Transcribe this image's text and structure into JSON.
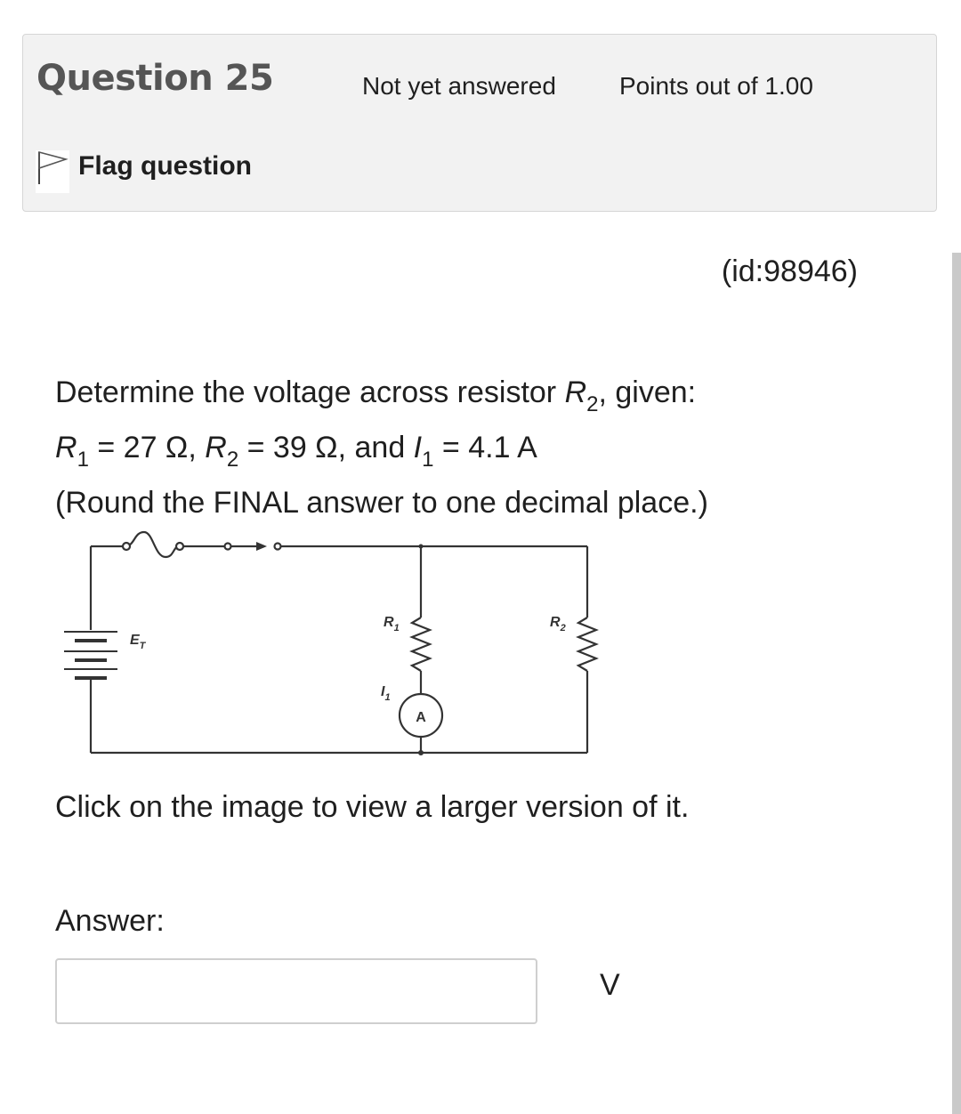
{
  "header": {
    "question_word": "Question",
    "question_number": "25",
    "state": "Not yet answered",
    "grade": "Points out of 1.00",
    "flag_label": "Flag question"
  },
  "question": {
    "id_text": "(id:98946)",
    "line1_prefix": "Determine the voltage across resistor ",
    "line1_var": "R",
    "line1_sub": "2",
    "line1_suffix": ", given:",
    "line2": {
      "r1_var": "R",
      "r1_sub": "1",
      "r1_val": " = 27 Ω, ",
      "r2_var": "R",
      "r2_sub": "2",
      "r2_val": " = 39 Ω, and ",
      "i1_var": "I",
      "i1_sub": "1",
      "i1_val": " = 4.1 A"
    },
    "line3": "(Round the FINAL answer to one decimal place.)",
    "click_note": "Click on the image to view a larger version of it."
  },
  "circuit": {
    "source_label": "E",
    "source_sub": "T",
    "r1_label": "R",
    "r1_sub": "1",
    "r2_label": "R",
    "r2_sub": "2",
    "current_label": "I",
    "current_sub": "1",
    "meter_label": "A"
  },
  "answer": {
    "label": "Answer:",
    "value": "",
    "unit": "V"
  }
}
